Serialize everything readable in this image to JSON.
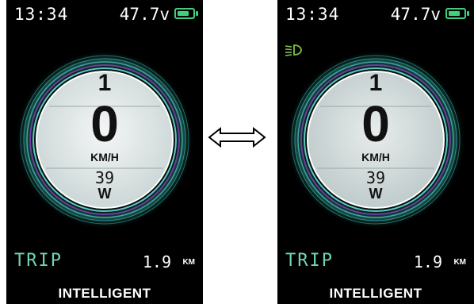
{
  "screens": [
    {
      "time": "13:34",
      "voltage": "47.7v",
      "assist_level": "1",
      "speed": "0",
      "speed_unit": "KM/H",
      "power": "39",
      "power_unit": "W",
      "trip_label": "TRIP",
      "trip_value": "1.9",
      "trip_unit": "KM",
      "mode": "INTELLIGENT",
      "headlight_on": false
    },
    {
      "time": "13:34",
      "voltage": "47.7v",
      "assist_level": "1",
      "speed": "0",
      "speed_unit": "KM/H",
      "power": "39",
      "power_unit": "W",
      "trip_label": "TRIP",
      "trip_value": "1.9",
      "trip_unit": "KM",
      "mode": "INTELLIGENT",
      "headlight_on": true
    }
  ],
  "icons": {
    "battery": "battery-icon",
    "headlight": "headlight-icon",
    "toggle_arrow": "double-arrow-icon"
  },
  "colors": {
    "screen_bg": "#000000",
    "accent_teal": "#6fd3b6",
    "battery_green": "#3ed07c",
    "headlight_green": "#7fc24a",
    "gauge_face": "#e6eaea",
    "ring_purple": "#6b3fa0"
  }
}
